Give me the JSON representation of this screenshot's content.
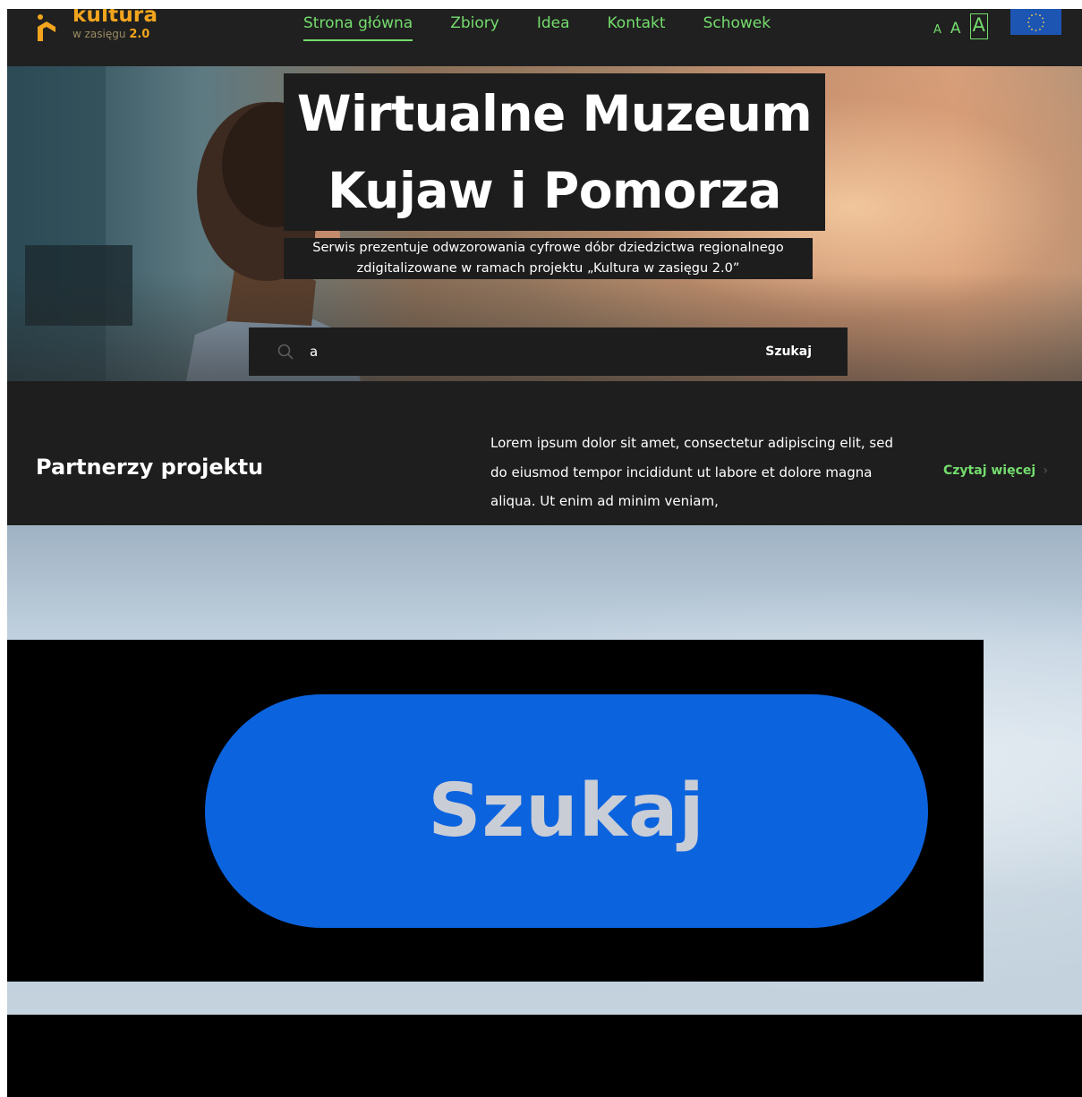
{
  "header": {
    "logo": {
      "main": "kultura",
      "sub": "w zasięgu",
      "version": "2.0"
    },
    "nav": [
      {
        "label": "Strona główna",
        "active": true
      },
      {
        "label": "Zbiory",
        "active": false
      },
      {
        "label": "Idea",
        "active": false
      },
      {
        "label": "Kontakt",
        "active": false
      },
      {
        "label": "Schowek",
        "active": false
      }
    ],
    "font_sizes": {
      "small": "A",
      "medium": "A",
      "large": "A"
    }
  },
  "hero": {
    "title_line1": "Wirtualne Muzeum",
    "title_line2": "Kujaw i Pomorza",
    "subtitle_line1": "Serwis prezentuje odwzorowania cyfrowe dóbr dziedzictwa regionalnego",
    "subtitle_line2": "zdigitalizowane w ramach projektu „Kultura w zasięgu 2.0”",
    "search": {
      "value": "a",
      "button": "Szukaj"
    }
  },
  "partners": {
    "title": "Partnerzy projektu",
    "text": "Lorem ipsum dolor sit amet, consectetur adipiscing elit, sed do eiusmod tempor incididunt ut labore et dolore magna aliqua. Ut enim ad minim veniam,",
    "read_more": "Czytaj więcej"
  },
  "zoom": {
    "button": "Szukaj"
  },
  "colors": {
    "accent": "#74dd6d",
    "brand": "#f2a51d",
    "dark": "#1e1e1e",
    "button_blue": "#0c63de"
  }
}
